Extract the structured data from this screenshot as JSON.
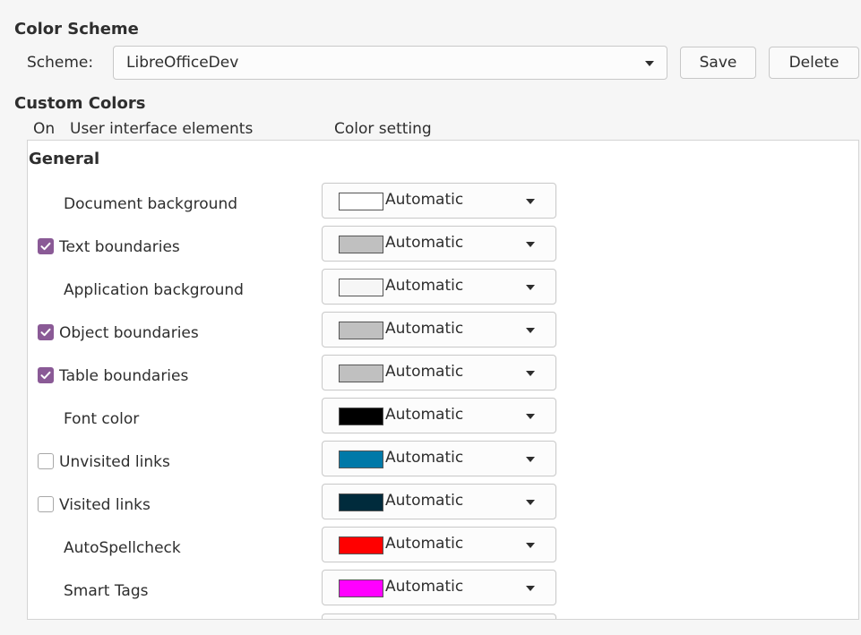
{
  "color_scheme": {
    "title": "Color Scheme",
    "scheme_label": "Scheme:",
    "scheme_value": "LibreOfficeDev",
    "save_label": "Save",
    "delete_label": "Delete"
  },
  "custom_colors": {
    "title": "Custom Colors",
    "col_on": "On",
    "col_elements": "User interface elements",
    "col_setting": "Color setting",
    "group_general": "General",
    "rows": [
      {
        "label": "Document background",
        "checkbox": null,
        "swatch": "#ffffff",
        "value": "Automatic"
      },
      {
        "label": "Text boundaries",
        "checkbox": true,
        "swatch": "#c0c0c0",
        "value": "Automatic"
      },
      {
        "label": "Application background",
        "checkbox": null,
        "swatch": "#f6f6f6",
        "value": "Automatic"
      },
      {
        "label": "Object boundaries",
        "checkbox": true,
        "swatch": "#c0c0c0",
        "value": "Automatic"
      },
      {
        "label": "Table boundaries",
        "checkbox": true,
        "swatch": "#c0c0c0",
        "value": "Automatic"
      },
      {
        "label": "Font color",
        "checkbox": null,
        "swatch": "#000000",
        "value": "Automatic"
      },
      {
        "label": "Unvisited links",
        "checkbox": false,
        "swatch": "#0079a8",
        "value": "Automatic"
      },
      {
        "label": "Visited links",
        "checkbox": false,
        "swatch": "#002b3c",
        "value": "Automatic"
      },
      {
        "label": "AutoSpellcheck",
        "checkbox": null,
        "swatch": "#ff0000",
        "value": "Automatic"
      },
      {
        "label": "Smart Tags",
        "checkbox": null,
        "swatch": "#ff00ff",
        "value": "Automatic"
      }
    ]
  },
  "colors": {
    "checkbox_accent": "#8a5a96",
    "window_bg": "#f6f6f6"
  }
}
